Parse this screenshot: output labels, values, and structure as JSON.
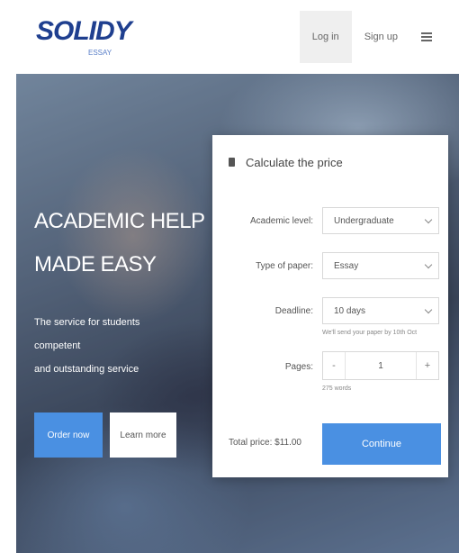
{
  "header": {
    "logo_main": "SOLIDY",
    "logo_sub": "ESSAY",
    "nav": {
      "login_label": "Log in",
      "signup_label": "Sign up"
    },
    "menu_icon": "hamburger-menu-icon"
  },
  "hero": {
    "title_line1": "ACADEMIC HELP",
    "title_line2": "MADE EASY",
    "text_line1": "The service for students",
    "text_line2": "competent",
    "text_line3": "and outstanding service",
    "primary_button": "Order now",
    "secondary_button": "Learn more"
  },
  "calculator": {
    "title": "Calculate the price",
    "icon": "calculator-icon",
    "academic_level": {
      "label": "Academic level:",
      "value": "Undergraduate"
    },
    "type_of_paper": {
      "label": "Type of paper:",
      "value": "Essay"
    },
    "deadline": {
      "label": "Deadline:",
      "value": "10 days",
      "hint": "We'll send your paper by 10th Oct"
    },
    "pages": {
      "label": "Pages:",
      "minus": "-",
      "value": "1",
      "plus": "+",
      "hint": "275 words"
    },
    "total": "Total price: $11.00",
    "continue_button": "Continue"
  },
  "colors": {
    "accent": "#4a90e2",
    "logo": "#1f3f8f"
  }
}
